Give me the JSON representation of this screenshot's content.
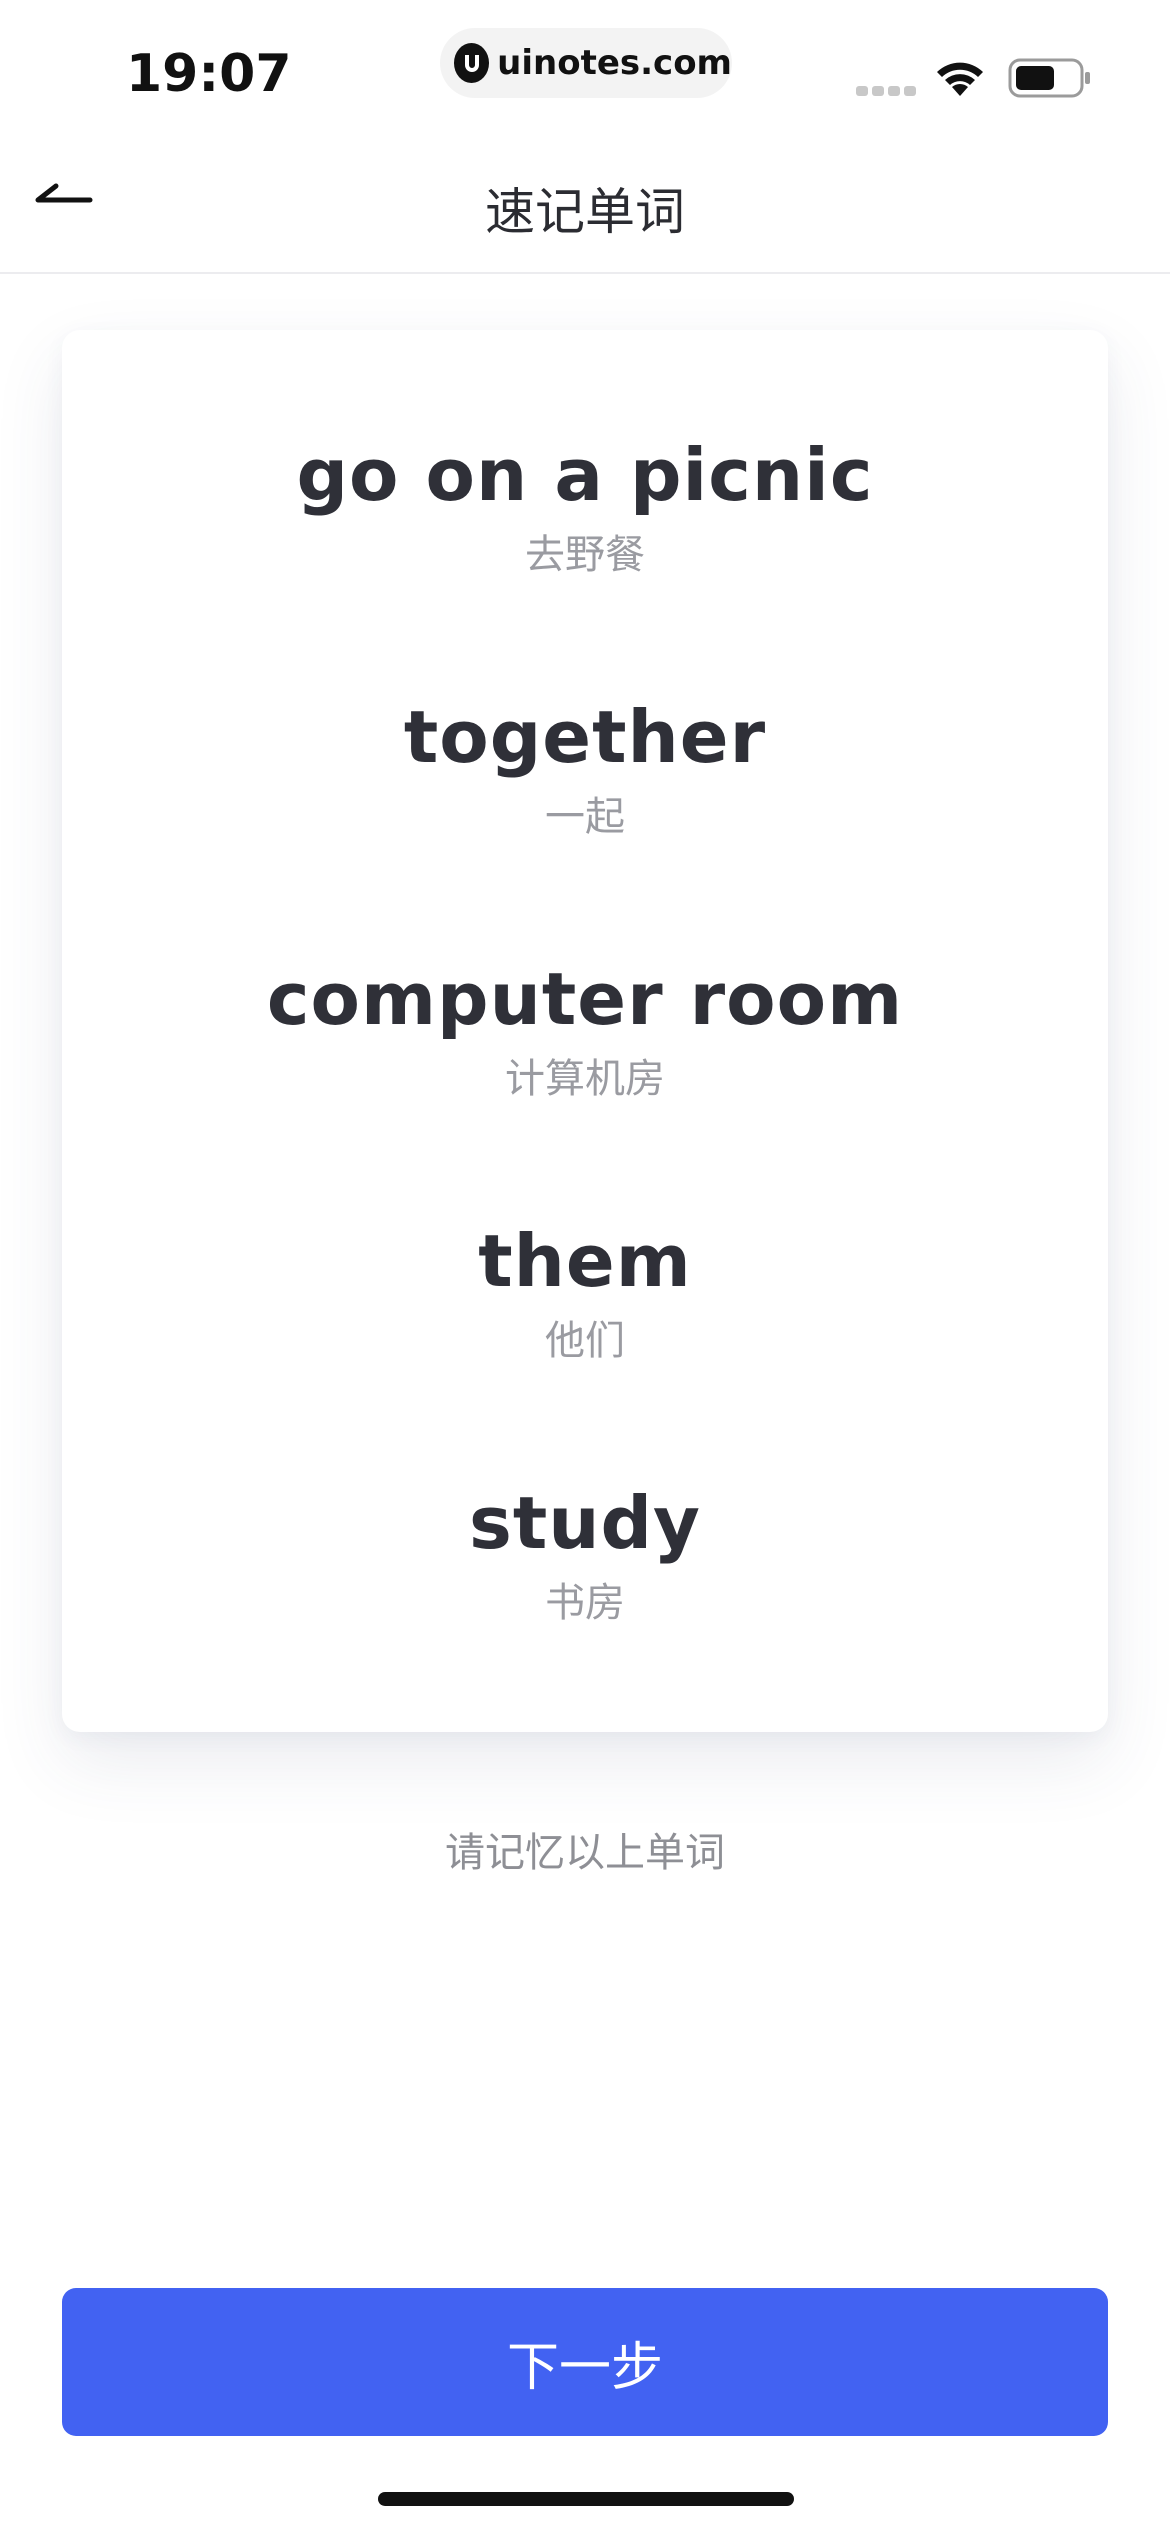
{
  "status_bar": {
    "time": "19:07",
    "url": "uinotes.com",
    "icons": [
      "signal-icon",
      "wifi-icon",
      "battery-icon"
    ]
  },
  "nav": {
    "title": "速记单词",
    "back_icon": "back-arrow-icon"
  },
  "words": [
    {
      "en": "go on a picnic",
      "cn": "去野餐"
    },
    {
      "en": "together",
      "cn": "一起"
    },
    {
      "en": "computer room",
      "cn": "计算机房"
    },
    {
      "en": "them",
      "cn": "他们"
    },
    {
      "en": "study",
      "cn": "书房"
    }
  ],
  "hint": "请记忆以上单词",
  "next_button_label": "下一步",
  "colors": {
    "accent": "#4262f2",
    "word_text": "#2f3038",
    "translation_text": "#9a9ba1"
  }
}
